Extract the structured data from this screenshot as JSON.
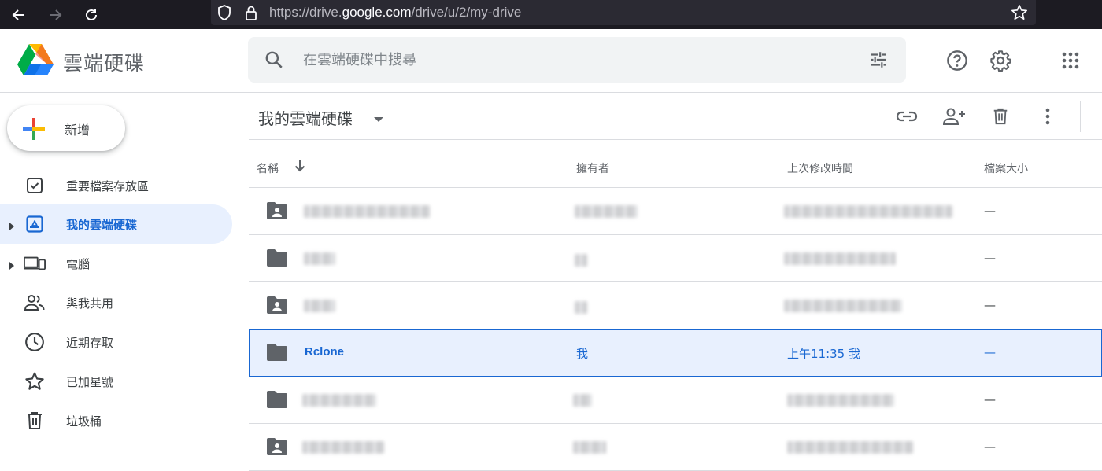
{
  "browser": {
    "url_prefix": "https://drive.",
    "url_domain": "google.com",
    "url_path": "/drive/u/2/my-drive"
  },
  "header": {
    "app_title": "雲端硬碟",
    "search_placeholder": "在雲端硬碟中搜尋"
  },
  "sidebar": {
    "new_label": "新增",
    "items": [
      {
        "label": "重要檔案存放區",
        "icon": "priority-check-icon"
      },
      {
        "label": "我的雲端硬碟",
        "icon": "my-drive-icon"
      },
      {
        "label": "電腦",
        "icon": "computers-icon"
      },
      {
        "label": "與我共用",
        "icon": "shared-people-icon"
      },
      {
        "label": "近期存取",
        "icon": "clock-icon"
      },
      {
        "label": "已加星號",
        "icon": "star-icon"
      },
      {
        "label": "垃圾桶",
        "icon": "trash-icon"
      }
    ]
  },
  "main": {
    "folder_title": "我的雲端硬碟",
    "columns": {
      "name": "名稱",
      "owner": "擁有者",
      "modified": "上次修改時間",
      "size": "檔案大小"
    },
    "rows": [
      {
        "name": "",
        "owner": "",
        "modified": "",
        "size": "—",
        "icon": "shared-folder-icon"
      },
      {
        "name": "",
        "owner": "",
        "modified": "",
        "size": "—",
        "icon": "folder-icon"
      },
      {
        "name": "",
        "owner": "",
        "modified": "",
        "size": "—",
        "icon": "shared-folder-icon"
      },
      {
        "name": "Rclone",
        "owner": "我",
        "modified": "上午11:35 我",
        "size": "—",
        "icon": "folder-icon"
      },
      {
        "name": "",
        "owner": "",
        "modified": "",
        "size": "—",
        "icon": "folder-icon"
      },
      {
        "name": "",
        "owner": "",
        "modified": "",
        "size": "—",
        "icon": "shared-folder-icon"
      }
    ]
  },
  "colors": {
    "accent": "#1967d2",
    "selected_bg": "#e8f0fe",
    "icon_gray": "#5f6368"
  }
}
